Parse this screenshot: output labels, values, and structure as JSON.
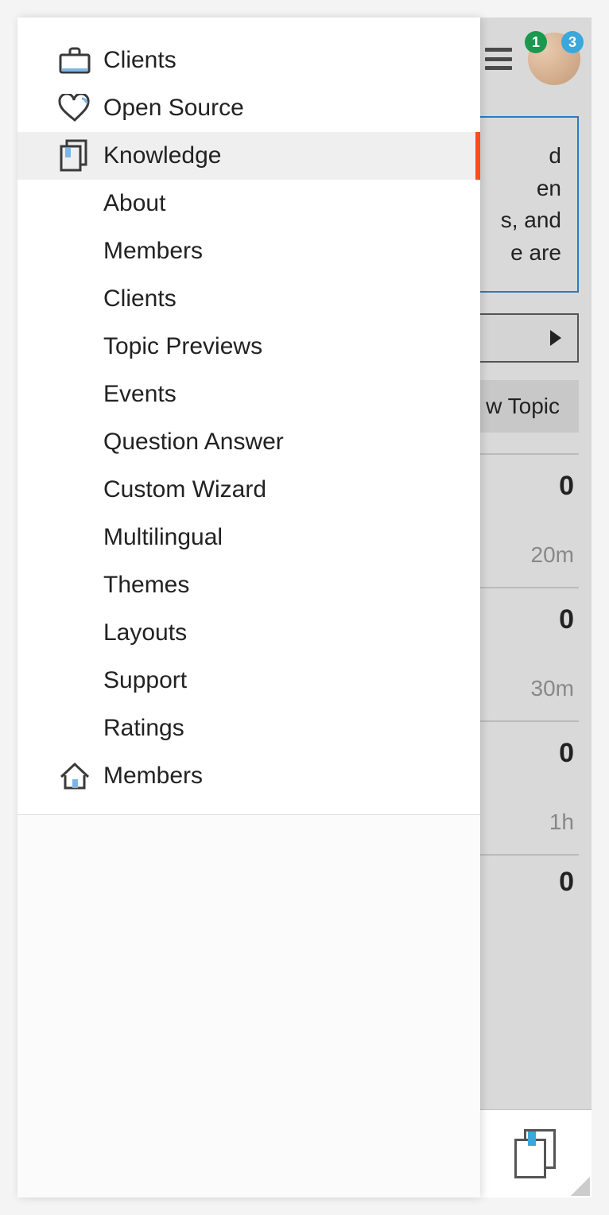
{
  "header": {
    "badge_green": "1",
    "badge_blue": "3"
  },
  "background": {
    "info_lines": [
      "d",
      "en",
      "s, and",
      "e are"
    ],
    "new_topic_label": "w Topic",
    "rows": [
      {
        "count": "0",
        "age": "20m"
      },
      {
        "count": "0",
        "age": "30m"
      },
      {
        "count": "0",
        "age": "1h"
      }
    ],
    "extra_count": "0"
  },
  "sidebar": {
    "main": [
      {
        "key": "clients",
        "label": "Clients",
        "icon": "briefcase"
      },
      {
        "key": "opensource",
        "label": "Open Source",
        "icon": "heart"
      },
      {
        "key": "knowledge",
        "label": "Knowledge",
        "icon": "docs",
        "active": true
      }
    ],
    "knowledge_sub": [
      {
        "key": "about",
        "label": "About"
      },
      {
        "key": "members",
        "label": "Members"
      },
      {
        "key": "clients",
        "label": "Clients"
      },
      {
        "key": "topic-previews",
        "label": "Topic Previews"
      },
      {
        "key": "events",
        "label": "Events"
      },
      {
        "key": "qa",
        "label": "Question Answer"
      },
      {
        "key": "custom-wizard",
        "label": "Custom Wizard"
      },
      {
        "key": "multilingual",
        "label": "Multilingual"
      },
      {
        "key": "themes",
        "label": "Themes"
      },
      {
        "key": "layouts",
        "label": "Layouts"
      },
      {
        "key": "support",
        "label": "Support"
      },
      {
        "key": "ratings",
        "label": "Ratings"
      }
    ],
    "footer": {
      "key": "members-home",
      "label": "Members",
      "icon": "house"
    }
  }
}
